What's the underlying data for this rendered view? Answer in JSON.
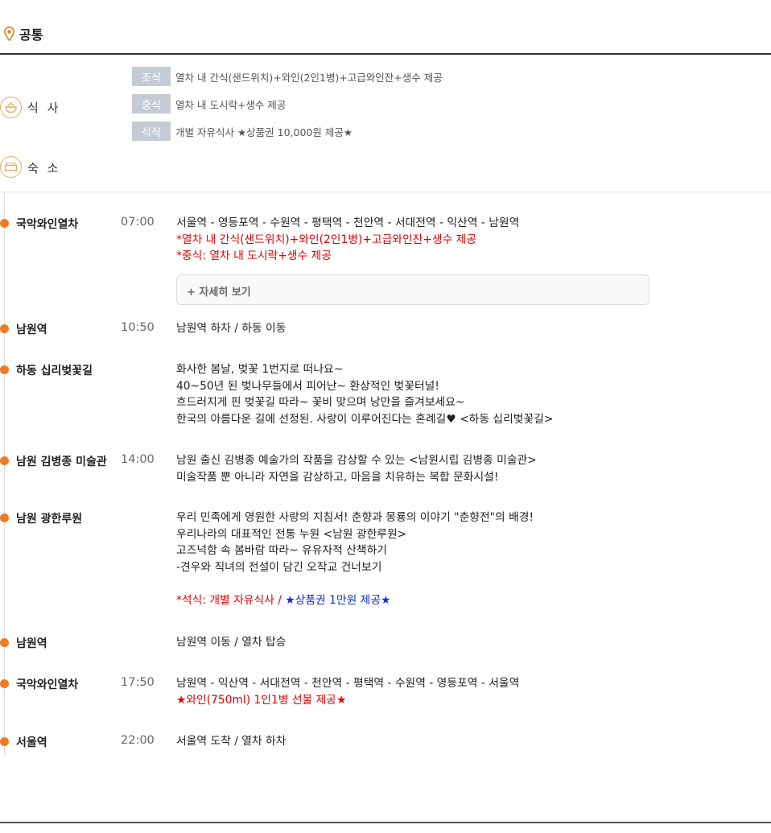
{
  "header": {
    "title": "공통"
  },
  "meals": {
    "meal_label": "식 사",
    "lodging_label": "숙 소",
    "items": [
      {
        "badge": "조식",
        "text": "열차 내 간식(샌드위치)+와인(2인1병)+고급와인잔+생수 제공"
      },
      {
        "badge": "중식",
        "text": "열차 내 도시락+생수 제공"
      },
      {
        "badge": "석식",
        "text": "개별 자유식사 ★상품권 10,000원 제공★"
      }
    ]
  },
  "timeline": [
    {
      "place": "국악와인열차",
      "time": "07:00",
      "lines": [
        "서울역 - 영등포역 - 수원역 - 평택역 - 천안역 - 서대전역 - 익산역 - 남원역",
        "*열차 내 간식(샌드위치)+와인(2인1병)+고급와인잔+생수 제공",
        "*중식: 열차 내 도시락+생수 제공"
      ]
    },
    {
      "place": "남원역",
      "time": "10:50",
      "lines": [
        "남원역 하차 / 하동 이동"
      ]
    },
    {
      "place": "하동 십리벚꽃길",
      "time": "",
      "lines": [
        "화사한 봄날, 벚꽃 1번지로 떠나요~",
        "40~50년 된 벚나무들에서 피어난~ 환상적인 벚꽃터널!",
        "흐드러지게 핀 벚꽃길 따라~ 꽃비 맞으며 낭만을 즐겨보세요~",
        "한국의 아름다운 길에 선정된. 사랑이 이루어진다는 혼례길♥  <하동 십리벚꽃길>"
      ]
    },
    {
      "place": "남원 김병종 미술관",
      "time": "14:00",
      "lines": [
        "남원 출신 김병종 예술가의 작품을 감상할 수 있는 <남원시립 김병종 미술관>",
        "미술작품 뿐 아니라 자연을 감상하고, 마음을 치유하는 복합 문화시설!"
      ]
    },
    {
      "place": "남원 광한루원",
      "time": "",
      "lines": [
        "우리 민족에게 영원한 사랑의 지침서! 춘향과 몽룡의 이야기 \"춘향전\"의 배경!",
        "우리나라의 대표적인 전통 누원 <남원 광한루원>",
        "고즈넉함 속 봄바람 따라~ 유유자적 산책하기",
        "-견우와 직녀의 전설이 담긴 오작교 건너보기"
      ],
      "note_red": "*석식: 개별 자유식사 / ",
      "note_blue": "★상품권 1만원 제공★"
    },
    {
      "place": "남원역",
      "time": "",
      "lines": [
        "남원역 이동 / 열차 탑승"
      ]
    },
    {
      "place": "국악와인열차",
      "time": "17:50",
      "lines": [
        "남원역 - 익산역 - 서대전역 - 천안역 - 평택역 - 수원역 - 영등포역 - 서울역",
        "★와인(750ml) 1인1병 선물 제공★"
      ]
    },
    {
      "place": "서울역",
      "time": "22:00",
      "lines": [
        "서울역 도착 / 열차 하차"
      ]
    }
  ],
  "detail_button": {
    "label": "+ 자세히 보기"
  },
  "colors": {
    "accent": "#f07b20",
    "badge": "#c3cbd5",
    "red": "#e00000",
    "blue": "#1030d0"
  },
  "icons": [
    "location-pin-icon",
    "meal-bowl-icon",
    "bed-icon"
  ]
}
